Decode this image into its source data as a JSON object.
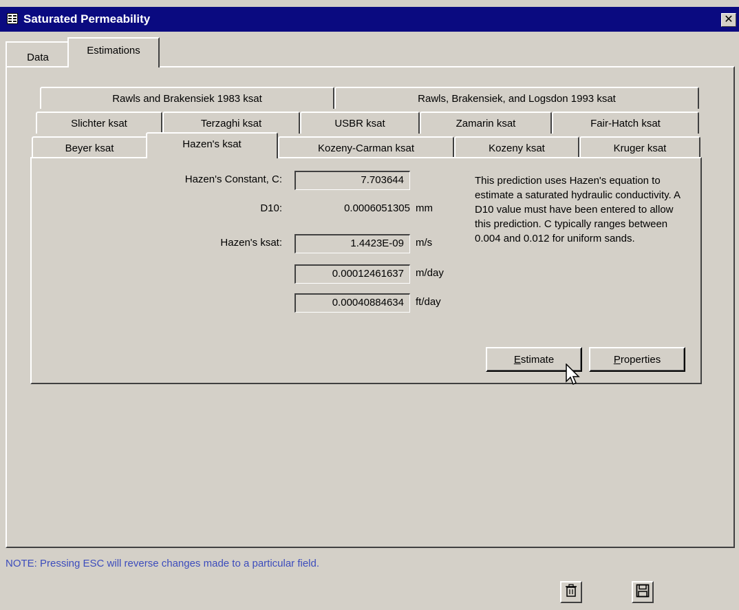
{
  "window": {
    "title": "Saturated Permeability",
    "close_symbol": "✕"
  },
  "outer_tabs": [
    {
      "label": "Data",
      "active": false
    },
    {
      "label": "Estimations",
      "active": true
    }
  ],
  "inner_tabs": {
    "row1": [
      "Rawls and Brakensiek 1983 ksat",
      "Rawls, Brakensiek, and Logsdon 1993 ksat"
    ],
    "row2": [
      "Slichter ksat",
      "Terzaghi ksat",
      "USBR ksat",
      "Zamarin ksat",
      "Fair-Hatch ksat"
    ],
    "row3": [
      "Beyer ksat",
      "Hazen's ksat",
      "Kozeny-Carman ksat",
      "Kozeny ksat",
      "Kruger ksat"
    ],
    "active": "Hazen's ksat"
  },
  "hazen": {
    "constant_label": "Hazen's Constant, C:",
    "constant_value": "7.703644",
    "d10_label": "D10:",
    "d10_value": "0.0006051305",
    "d10_unit": "mm",
    "ksat_label": "Hazen's ksat:",
    "ksat_ms": "1.4423E-09",
    "ksat_ms_unit": "m/s",
    "ksat_mday": "0.00012461637",
    "ksat_mday_unit": "m/day",
    "ksat_ftday": "0.00040884634",
    "ksat_ftday_unit": "ft/day",
    "description": "This prediction uses Hazen's equation to estimate a saturated hydraulic conductivity. A D10 value must have been entered to allow this prediction. C typically ranges between 0.004 and 0.012 for uniform sands."
  },
  "buttons": {
    "estimate_mnemonic": "E",
    "estimate_rest": "stimate",
    "properties_mnemonic": "P",
    "properties_rest": "roperties"
  },
  "footer": {
    "note": "NOTE: Pressing ESC will reverse changes made to a particular field.",
    "delete_icon": "trash-icon",
    "save_icon": "floppy-disk-icon"
  },
  "colors": {
    "titlebar": "#0a0a80",
    "window_bg": "#d4d0c8",
    "note_text": "#3c4cbc"
  }
}
